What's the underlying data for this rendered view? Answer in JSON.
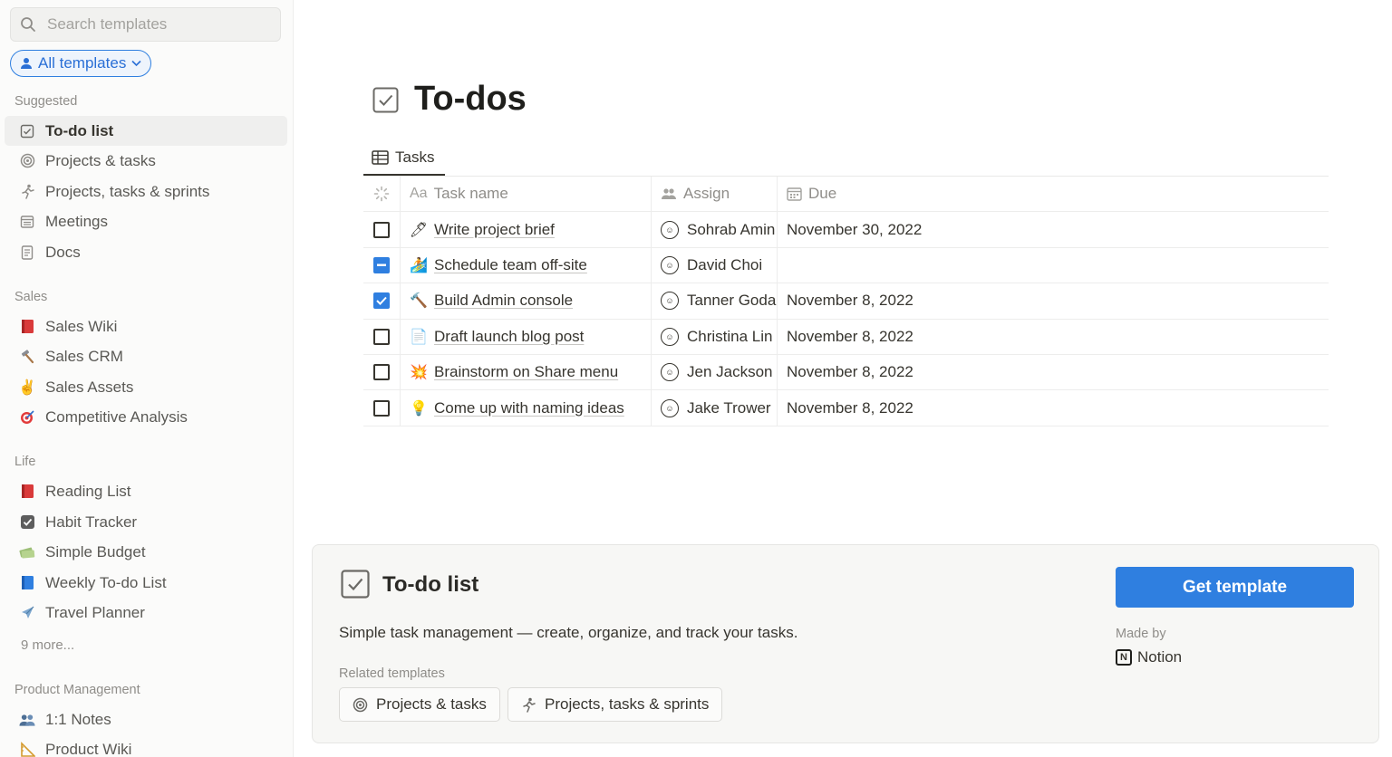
{
  "sidebar": {
    "search_placeholder": "Search templates",
    "filter_label": "All templates",
    "sections": [
      {
        "label": "Suggested",
        "items": [
          {
            "label": "To-do list",
            "icon": "checkbox-icon",
            "active": true
          },
          {
            "label": "Projects & tasks",
            "icon": "target-icon"
          },
          {
            "label": "Projects, tasks & sprints",
            "icon": "runner-icon"
          },
          {
            "label": "Meetings",
            "icon": "calendar-icon"
          },
          {
            "label": "Docs",
            "icon": "document-icon"
          }
        ]
      },
      {
        "label": "Sales",
        "items": [
          {
            "label": "Sales Wiki",
            "icon": "red-book-icon"
          },
          {
            "label": "Sales CRM",
            "icon": "hammer-icon"
          },
          {
            "label": "Sales Assets",
            "icon": "victory-hand-icon"
          },
          {
            "label": "Competitive Analysis",
            "icon": "dart-icon"
          }
        ]
      },
      {
        "label": "Life",
        "items": [
          {
            "label": "Reading List",
            "icon": "red-book-icon"
          },
          {
            "label": "Habit Tracker",
            "icon": "check-box-icon"
          },
          {
            "label": "Simple Budget",
            "icon": "money-icon"
          },
          {
            "label": "Weekly To-do List",
            "icon": "blue-book-icon"
          },
          {
            "label": "Travel Planner",
            "icon": "airplane-icon"
          }
        ],
        "more": "9 more..."
      },
      {
        "label": "Product Management",
        "items": [
          {
            "label": "1:1 Notes",
            "icon": "people-icon"
          },
          {
            "label": "Product Wiki",
            "icon": "ruler-icon"
          }
        ]
      }
    ]
  },
  "preview": {
    "title": "To-dos",
    "tab_label": "Tasks",
    "columns": {
      "name": "Task name",
      "assign": "Assign",
      "due": "Due",
      "name_prefix": "Aa"
    },
    "tasks": [
      {
        "name": "Write project brief",
        "emoji": "🖊",
        "assignee": "Sohrab Amin",
        "due": "November 30, 2022",
        "status": "empty"
      },
      {
        "name": "Schedule team off-site",
        "emoji": "🏄",
        "assignee": "David Choi",
        "due": "",
        "status": "partial"
      },
      {
        "name": "Build Admin console",
        "emoji": "🔨",
        "assignee": "Tanner Goda",
        "due": "November 8, 2022",
        "status": "checked"
      },
      {
        "name": "Draft launch blog post",
        "emoji": "📄",
        "assignee": "Christina Lin",
        "due": "November 8, 2022",
        "status": "empty"
      },
      {
        "name": "Brainstorm on Share menu",
        "emoji": "💥",
        "assignee": "Jen Jackson",
        "due": "November 8, 2022",
        "status": "empty"
      },
      {
        "name": "Come up with naming ideas",
        "emoji": "💡",
        "assignee": "Jake Trower",
        "due": "November 8, 2022",
        "status": "empty"
      }
    ]
  },
  "card": {
    "title": "To-do list",
    "description": "Simple task management — create, organize, and track your tasks.",
    "related_label": "Related templates",
    "related": [
      "Projects & tasks",
      "Projects, tasks & sprints"
    ],
    "cta": "Get template",
    "made_by_label": "Made by",
    "made_by": "Notion",
    "made_by_logo": "N"
  },
  "colors": {
    "accent": "#2f7fe0",
    "text": "#37352f",
    "muted": "#8f8d89"
  }
}
